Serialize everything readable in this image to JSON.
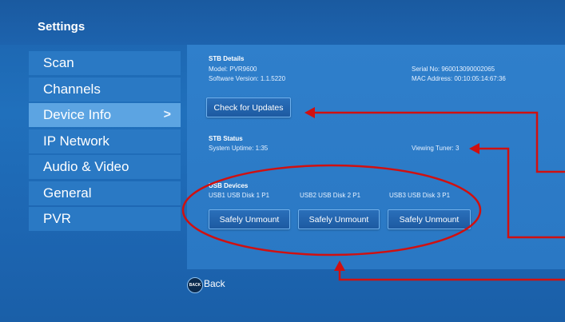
{
  "header": {
    "title": "Settings"
  },
  "sidebar": {
    "items": [
      {
        "label": "Scan"
      },
      {
        "label": "Channels"
      },
      {
        "label": "Device Info"
      },
      {
        "label": "IP Network"
      },
      {
        "label": "Audio & Video"
      },
      {
        "label": "General"
      },
      {
        "label": "PVR"
      }
    ],
    "active_chevron": ">"
  },
  "stb_details": {
    "heading": "STB Details",
    "model": "Model: PVR9600",
    "software_version": "Software Version: 1.1.5220",
    "serial_no": "Serial No: 960013090002065",
    "mac_address": "MAC Address: 00:10:05:14:67:36",
    "check_updates_label": "Check for Updates"
  },
  "stb_status": {
    "heading": "STB Status",
    "uptime": "System Uptime: 1:35",
    "viewing_tuner": "Viewing Tuner: 3"
  },
  "usb_devices": {
    "heading": "USB Devices",
    "devices": [
      {
        "name": "USB1 USB Disk 1 P1",
        "button": "Safely Unmount"
      },
      {
        "name": "USB2 USB Disk 2 P1",
        "button": "Safely Unmount"
      },
      {
        "name": "USB3 USB Disk 3 P1",
        "button": "Safely Unmount"
      }
    ]
  },
  "footer": {
    "back_icon_text": "BACK",
    "back_label": "Back"
  },
  "colors": {
    "annotation": "#d01010",
    "active_item": "#5ca4e2"
  }
}
